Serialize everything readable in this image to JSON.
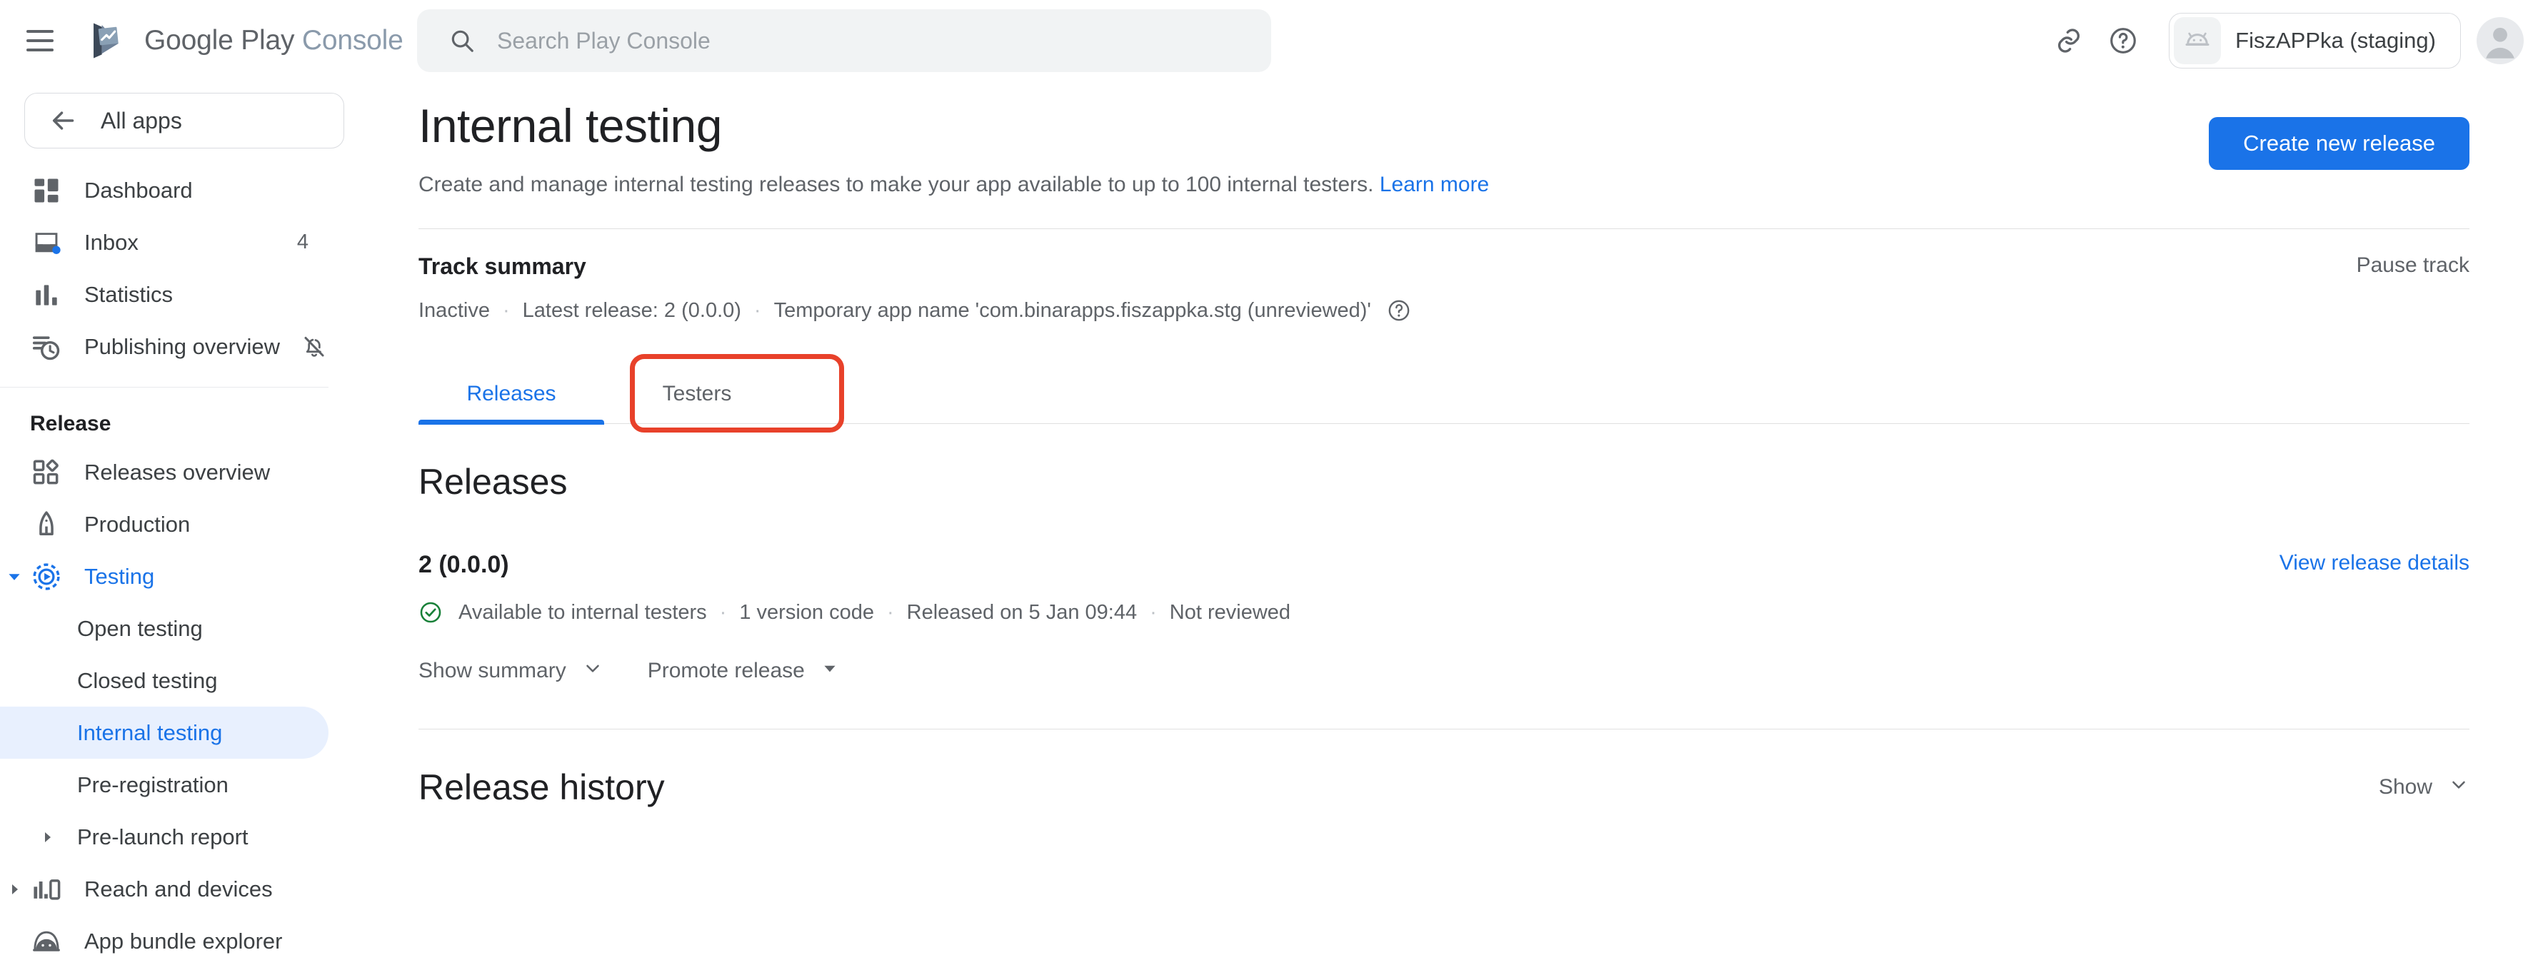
{
  "topbar": {
    "menu_icon": "hamburger-menu-icon",
    "brand_primary": "Google Play",
    "brand_secondary": "Console",
    "search": {
      "placeholder": "Search Play Console",
      "value": ""
    },
    "link_icon": "link-icon",
    "help_icon": "help-circle-icon",
    "app_chip_label": "FiszAPPka (staging)",
    "app_chip_icon": "android-head-icon",
    "avatar_icon": "user-avatar-icon"
  },
  "sidebar": {
    "all_apps": {
      "label": "All apps",
      "icon": "arrow-left-icon"
    },
    "items": [
      {
        "label": "Dashboard",
        "icon": "dashboard-icon",
        "badge": "",
        "active": false
      },
      {
        "label": "Inbox",
        "icon": "inbox-icon",
        "badge": "4",
        "active": false
      },
      {
        "label": "Statistics",
        "icon": "bar-chart-icon",
        "badge": "",
        "active": false
      },
      {
        "label": "Publishing overview",
        "icon": "publishing-clock-icon",
        "trailing_icon": "bell-off-icon",
        "badge": "",
        "active": false
      }
    ],
    "section_label": "Release",
    "release_items": [
      {
        "label": "Releases overview",
        "icon": "releases-overview-icon",
        "active": false,
        "expandable": false
      },
      {
        "label": "Production",
        "icon": "rocket-icon",
        "active": false,
        "expandable": false
      },
      {
        "label": "Testing",
        "icon": "testing-play-icon",
        "active": false,
        "expanded": true,
        "highlighted": true,
        "expandable": true
      }
    ],
    "testing_children": [
      {
        "label": "Open testing",
        "active": false,
        "expandable": false
      },
      {
        "label": "Closed testing",
        "active": false,
        "expandable": false
      },
      {
        "label": "Internal testing",
        "active": true,
        "expandable": false
      },
      {
        "label": "Pre-registration",
        "active": false,
        "expandable": false
      },
      {
        "label": "Pre-launch report",
        "active": false,
        "expandable": true
      }
    ],
    "bottom_items": [
      {
        "label": "Reach and devices",
        "icon": "reach-devices-icon",
        "expandable": true
      },
      {
        "label": "App bundle explorer",
        "icon": "app-bundle-icon",
        "expandable": false
      }
    ]
  },
  "page": {
    "title": "Internal testing",
    "description": "Create and manage internal testing releases to make your app available to up to 100 internal testers.",
    "learn_more": "Learn more",
    "create_release_button": "Create new release"
  },
  "track_summary": {
    "heading": "Track summary",
    "status": "Inactive",
    "latest_release": "Latest release: 2 (0.0.0)",
    "temp_app_name": "Temporary app name 'com.binarapps.fiszappka.stg (unreviewed)'",
    "help_icon": "help-circle-icon",
    "pause_track": "Pause track"
  },
  "tabs": {
    "items": [
      {
        "label": "Releases",
        "active": true
      },
      {
        "label": "Testers",
        "active": false,
        "annotated": true
      }
    ]
  },
  "releases": {
    "heading": "Releases",
    "version": "2 (0.0.0)",
    "view_details": "View release details",
    "status_icon": "check-circle-icon",
    "status_text": "Available to internal testers",
    "version_codes": "1 version code",
    "released_on": "Released on 5 Jan 09:44",
    "review_state": "Not reviewed",
    "show_summary": "Show summary",
    "promote_release": "Promote release",
    "chevron_icon": "chevron-down-icon",
    "caret_icon": "caret-down-icon"
  },
  "release_history": {
    "heading": "Release history",
    "show_label": "Show",
    "chevron_icon": "chevron-down-icon"
  },
  "colors": {
    "accent_blue": "#1a73e8",
    "annotation_red": "#e8412a",
    "success_green": "#188038",
    "text_primary": "#202124",
    "text_secondary": "#5f6368",
    "active_bg": "#e8f0fe"
  }
}
